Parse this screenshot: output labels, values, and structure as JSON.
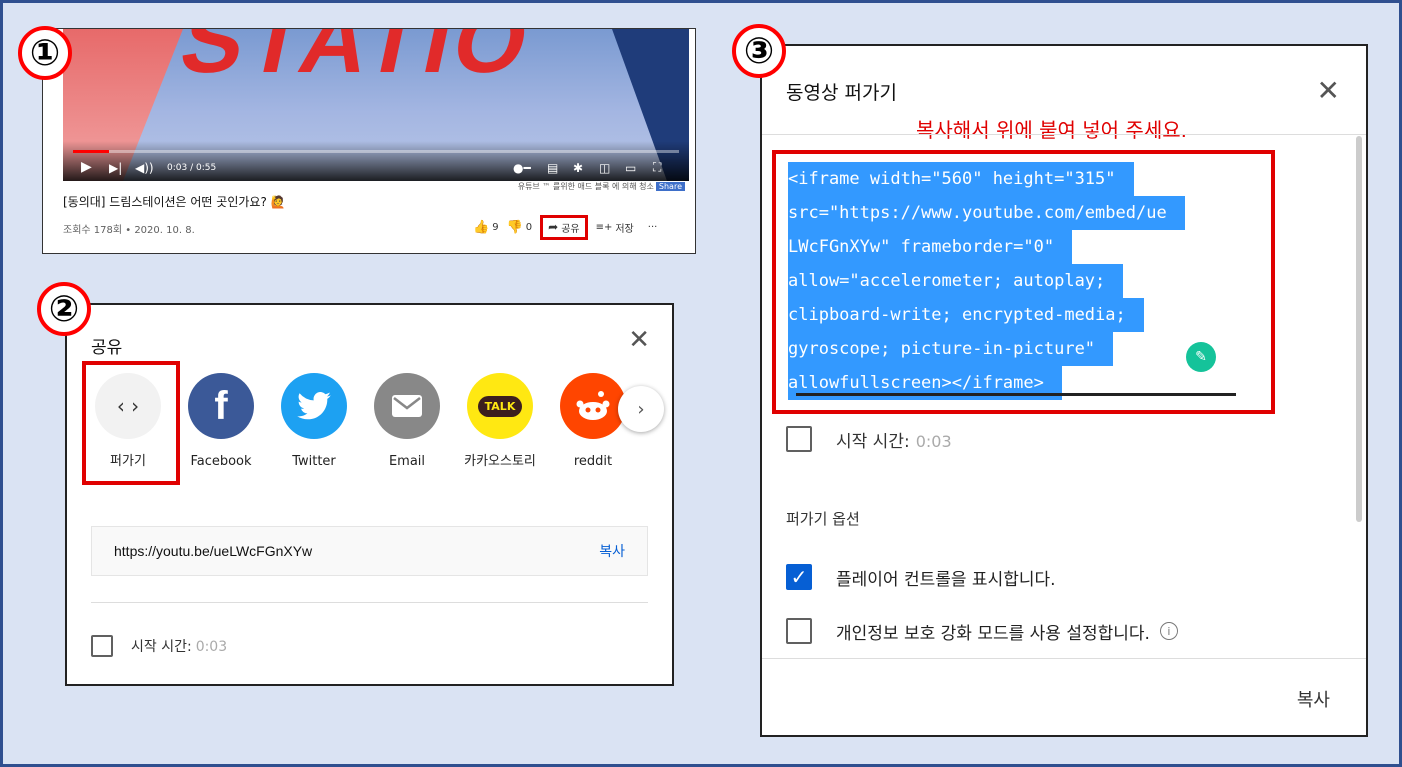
{
  "steps": [
    "①",
    "②",
    "③"
  ],
  "video": {
    "overlay_text": "STATIO",
    "time": "0:03 / 0:55",
    "progress": 0.06,
    "watermark": "유튜브 ™ 를위한 애드 블록 에 의해 청소",
    "watermark_tag": "Share",
    "title": "[동의대] 드림스테이션은 어떤 곳인가요? 🙋",
    "meta": "조회수 178회 • 2020. 10. 8.",
    "likes": "9",
    "dislikes": "0",
    "share_label": "공유",
    "save_label": "저장",
    "more": "···"
  },
  "share_dialog": {
    "title": "공유",
    "items": [
      {
        "label": "퍼가기",
        "icon": "embed-icon",
        "color": "#f2f2f2"
      },
      {
        "label": "Facebook",
        "icon": "facebook-icon",
        "color": "#3b5998"
      },
      {
        "label": "Twitter",
        "icon": "twitter-icon",
        "color": "#1da1f2"
      },
      {
        "label": "Email",
        "icon": "email-icon",
        "color": "#888888"
      },
      {
        "label": "카카오스토리",
        "icon": "kakao-icon",
        "color": "#ffe812"
      },
      {
        "label": "reddit",
        "icon": "reddit-icon",
        "color": "#ff4500"
      }
    ],
    "url": "https://youtu.be/ueLWcFGnXYw",
    "copy_label": "복사",
    "start_label": "시작 시간:",
    "start_time": "0:03"
  },
  "embed_dialog": {
    "title": "동영상 퍼가기",
    "note": "복사해서 위에 붙여 넣어 주세요.",
    "code_lines": [
      "<iframe width=\"560\" height=\"315\"",
      "src=\"https://www.youtube.com/embed/ue",
      "LWcFGnXYw\" frameborder=\"0\"",
      "allow=\"accelerometer; autoplay;",
      "clipboard-write; encrypted-media;",
      "gyroscope; picture-in-picture\"",
      "allowfullscreen></iframe>"
    ],
    "start_label": "시작 시간:",
    "start_time": "0:03",
    "options_title": "퍼가기 옵션",
    "option_controls": "플레이어 컨트롤을 표시합니다.",
    "option_controls_checked": true,
    "option_privacy": "개인정보 보호 강화 모드를 사용 설정합니다.",
    "option_privacy_checked": false,
    "copy_label": "복사"
  },
  "colors": {
    "highlight_red": "#e00000",
    "link_blue": "#065fd4",
    "selection_blue": "#3399ff"
  }
}
